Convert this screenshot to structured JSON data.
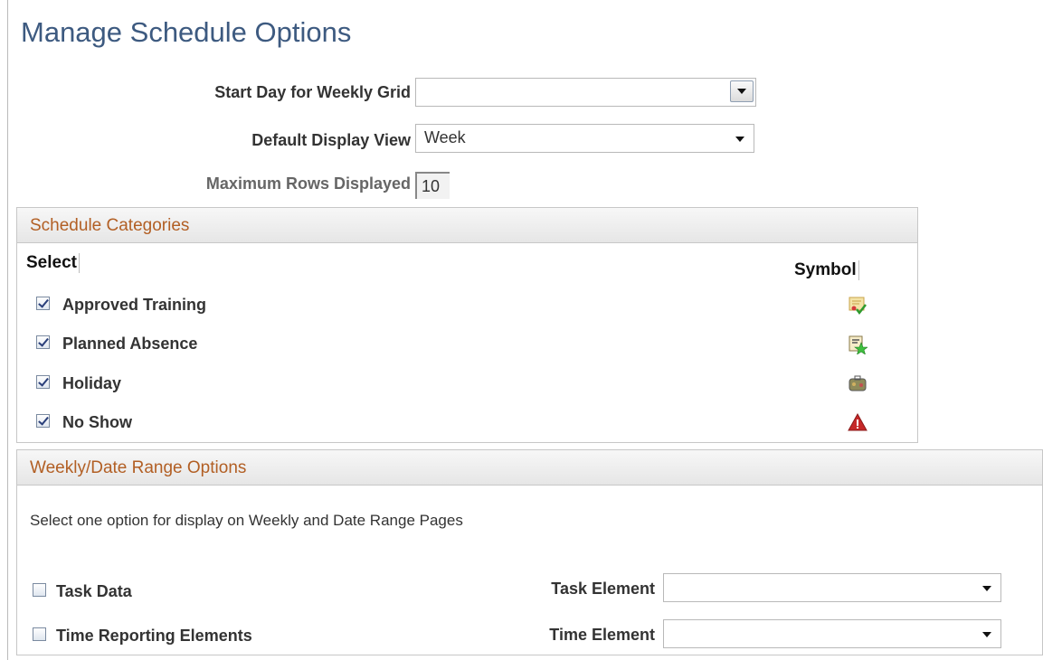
{
  "page": {
    "title": "Manage Schedule Options"
  },
  "form": {
    "start_day_label": "Start Day for Weekly Grid",
    "start_day_value": "",
    "default_view_label": "Default Display View",
    "default_view_value": "Week",
    "max_rows_label": "Maximum Rows Displayed",
    "max_rows_value": "10"
  },
  "categories": {
    "header": "Schedule Categories",
    "select_col": "Select",
    "symbol_col": "Symbol",
    "items": [
      {
        "label": "Approved Training",
        "checked": true,
        "icon": "approved-training-icon"
      },
      {
        "label": "Planned Absence",
        "checked": true,
        "icon": "planned-absence-icon"
      },
      {
        "label": "Holiday",
        "checked": true,
        "icon": "holiday-icon"
      },
      {
        "label": "No Show",
        "checked": true,
        "icon": "no-show-warning-icon"
      }
    ]
  },
  "weekly": {
    "header": "Weekly/Date Range Options",
    "instruction": "Select one option for display on Weekly and Date Range Pages",
    "task_data_label": "Task Data",
    "task_data_checked": false,
    "time_reporting_label": "Time Reporting Elements",
    "time_reporting_checked": false,
    "task_element_label": "Task Element",
    "task_element_value": "",
    "time_element_label": "Time Element",
    "time_element_value": ""
  },
  "colors": {
    "title": "#3d5a80",
    "section_header": "#b25f24",
    "check": "#2a3f7a"
  }
}
